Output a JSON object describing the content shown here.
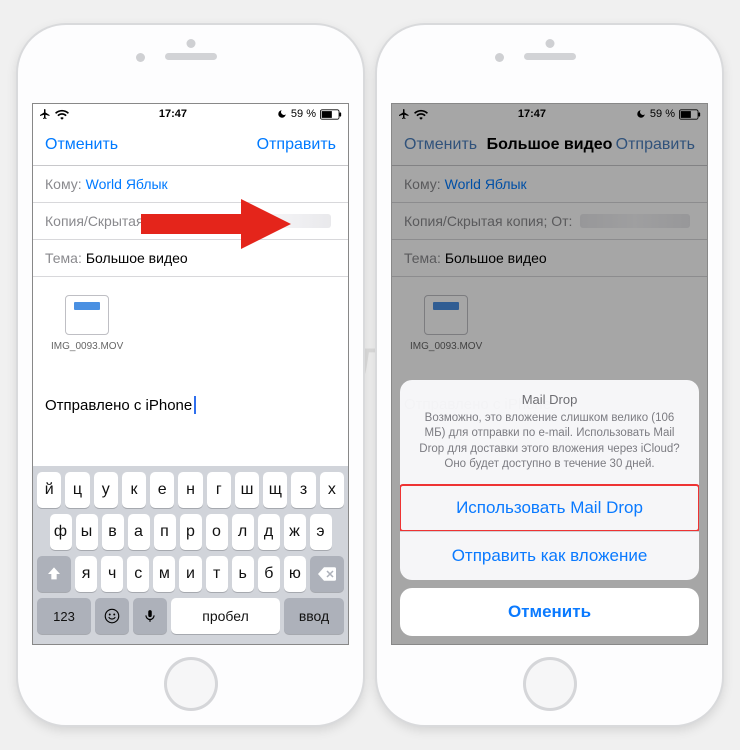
{
  "watermark": "Яблык",
  "status": {
    "time": "17:47",
    "battery_pct": "59 %",
    "airplane": "airplane-icon",
    "wifi": "wifi-icon",
    "moon": "dnd-moon-icon",
    "battery": "battery-icon"
  },
  "left": {
    "nav": {
      "cancel": "Отменить",
      "send": "Отправить"
    },
    "to_label": "Кому:",
    "to_value": "World Яблык",
    "cc_label": "Копия/Скрытая копия; От:",
    "subject_label": "Тема:",
    "subject_value": "Большое видео",
    "attachment_name": "IMG_0093.MOV",
    "signature": "Отправлено с iPhone",
    "keyboard": {
      "row1": [
        "й",
        "ц",
        "у",
        "к",
        "е",
        "н",
        "г",
        "ш",
        "щ",
        "з",
        "х"
      ],
      "row2": [
        "ф",
        "ы",
        "в",
        "а",
        "п",
        "р",
        "о",
        "л",
        "д",
        "ж",
        "э"
      ],
      "row3_mid": [
        "я",
        "ч",
        "с",
        "м",
        "и",
        "т",
        "ь",
        "б",
        "ю"
      ],
      "num_key": "123",
      "space": "Пробел",
      "return": "Ввод"
    }
  },
  "right": {
    "nav": {
      "cancel": "Отменить",
      "title": "Большое видео",
      "send": "Отправить"
    },
    "to_label": "Кому:",
    "to_value": "World Яблык",
    "cc_label": "Копия/Скрытая копия; От:",
    "subject_label": "Тема:",
    "subject_value": "Большое видео",
    "attachment_name": "IMG_0093.MOV",
    "signature": "Отправлено с iPhone",
    "sheet": {
      "title": "Mail Drop",
      "message": "Возможно, это вложение слишком велико (106 МБ) для отправки по e-mail. Использовать Mail Drop для доставки этого вложения через iCloud? Оно будет доступно в течение 30 дней.",
      "use_maildrop": "Использовать Mail Drop",
      "send_as_attachment": "Отправить как вложение",
      "cancel": "Отменить"
    }
  }
}
